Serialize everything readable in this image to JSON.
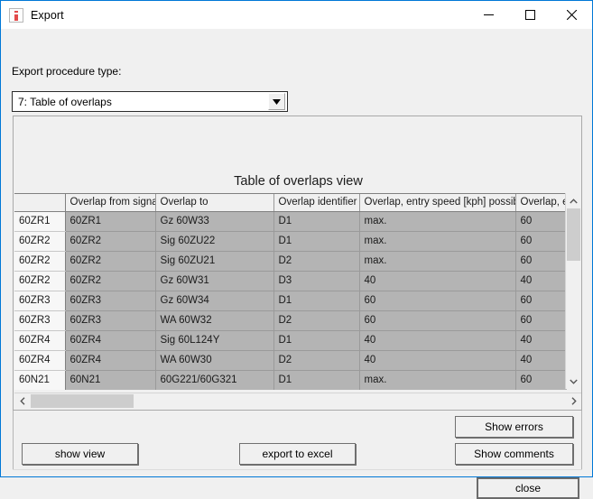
{
  "window": {
    "title": "Export",
    "icon": "export-app-icon",
    "controls": {
      "minimize": "minimize-icon",
      "maximize": "maximize-icon",
      "close": "close-icon"
    }
  },
  "form": {
    "procedure_type_label": "Export procedure type:",
    "procedure_type_value": "7: Table of overlaps",
    "dropdown_arrow": "chevron-down-icon"
  },
  "view": {
    "title": "Table of overlaps view"
  },
  "table": {
    "columns": [
      "",
      "Overlap from signal",
      "Overlap to",
      "Overlap identifier",
      "Overlap, entry speed [kph] possible",
      "Overlap, e"
    ],
    "rows": [
      [
        "60ZR1",
        "60ZR1",
        "Gz 60W33",
        "D1",
        "max.",
        "60"
      ],
      [
        "60ZR2",
        "60ZR2",
        "Sig 60ZU22",
        "D1",
        "max.",
        "60"
      ],
      [
        "60ZR2",
        "60ZR2",
        "Sig 60ZU21",
        "D2",
        "max.",
        "60"
      ],
      [
        "60ZR2",
        "60ZR2",
        "Gz 60W31",
        "D3",
        "40",
        "40"
      ],
      [
        "60ZR3",
        "60ZR3",
        "Gz 60W34",
        "D1",
        "60",
        "60"
      ],
      [
        "60ZR3",
        "60ZR3",
        "WA 60W32",
        "D2",
        "60",
        "60"
      ],
      [
        "60ZR4",
        "60ZR4",
        "Sig 60L124Y",
        "D1",
        "40",
        "40"
      ],
      [
        "60ZR4",
        "60ZR4",
        "WA 60W30",
        "D2",
        "40",
        "40"
      ],
      [
        "60N21",
        "60N21",
        "60G221/60G321",
        "D1",
        "max.",
        "60"
      ]
    ]
  },
  "scrollbars": {
    "vertical_up": "scroll-up-icon",
    "vertical_down": "scroll-down-icon",
    "horizontal_left": "scroll-left-icon",
    "horizontal_right": "scroll-right-icon"
  },
  "buttons": {
    "show_view": "show view",
    "export_to_excel": "export to excel",
    "show_errors": "Show errors",
    "show_comments": "Show comments",
    "close": "close"
  },
  "colors": {
    "window_border": "#0078d7",
    "dialog_bg": "#f0f0f0",
    "cell_bg": "#b4b4b4",
    "rowhead_bg": "#f7f7f7",
    "scroll_thumb": "#cdcdcd"
  }
}
